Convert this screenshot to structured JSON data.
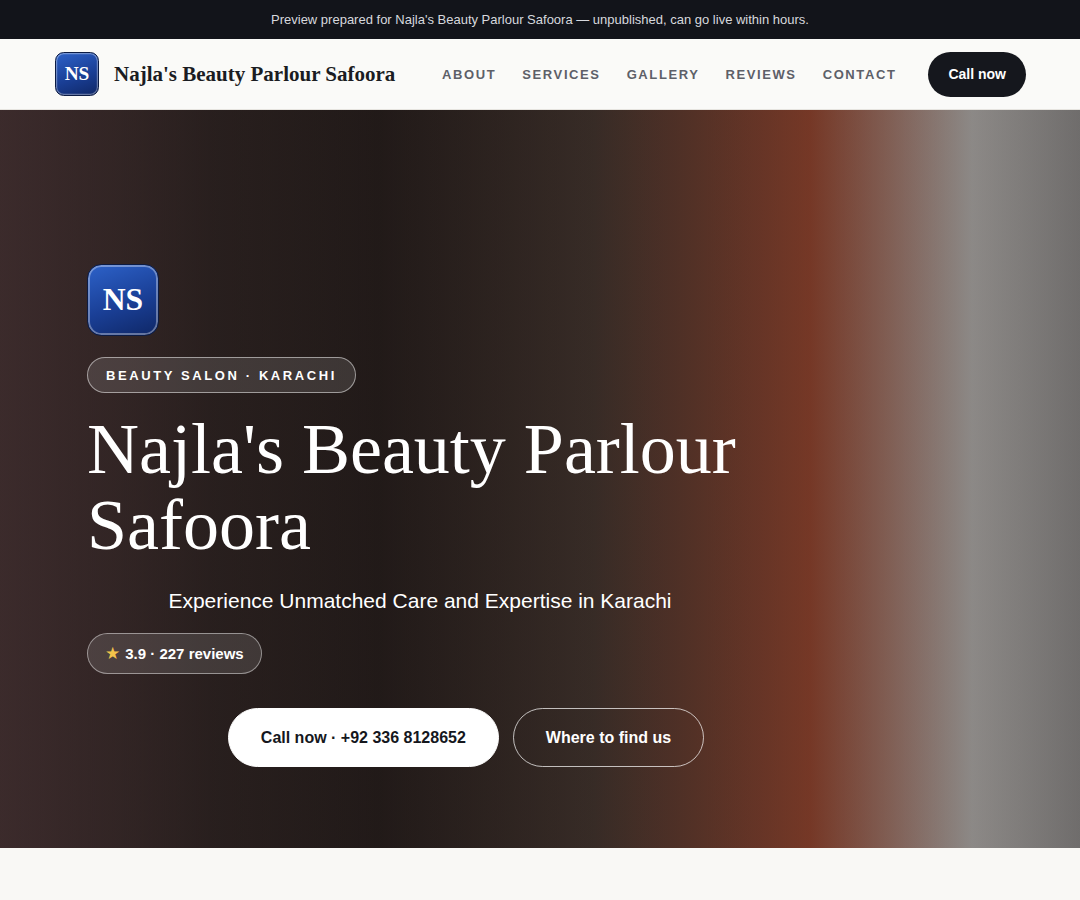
{
  "banner": {
    "text": "Preview prepared for Najla's Beauty Parlour Safoora — unpublished, can go live within hours."
  },
  "nav": {
    "logo": "NS",
    "brand": "Najla's Beauty Parlour Safoora",
    "links": [
      "ABOUT",
      "SERVICES",
      "GALLERY",
      "REVIEWS",
      "CONTACT"
    ],
    "cta": "Call now"
  },
  "hero": {
    "logo": "NS",
    "badge": "BEAUTY SALON · KARACHI",
    "title": "Najla's Beauty Parlour Safoora",
    "subtitle": "Experience Unmatched Care and Expertise in Karachi",
    "rating": {
      "star": "★",
      "text": "3.9 · 227 reviews"
    },
    "buttons": [
      {
        "label": "Call now · +92 336 8128652",
        "kind": "primary"
      },
      {
        "label": "Where to find us",
        "kind": "outline"
      }
    ]
  }
}
